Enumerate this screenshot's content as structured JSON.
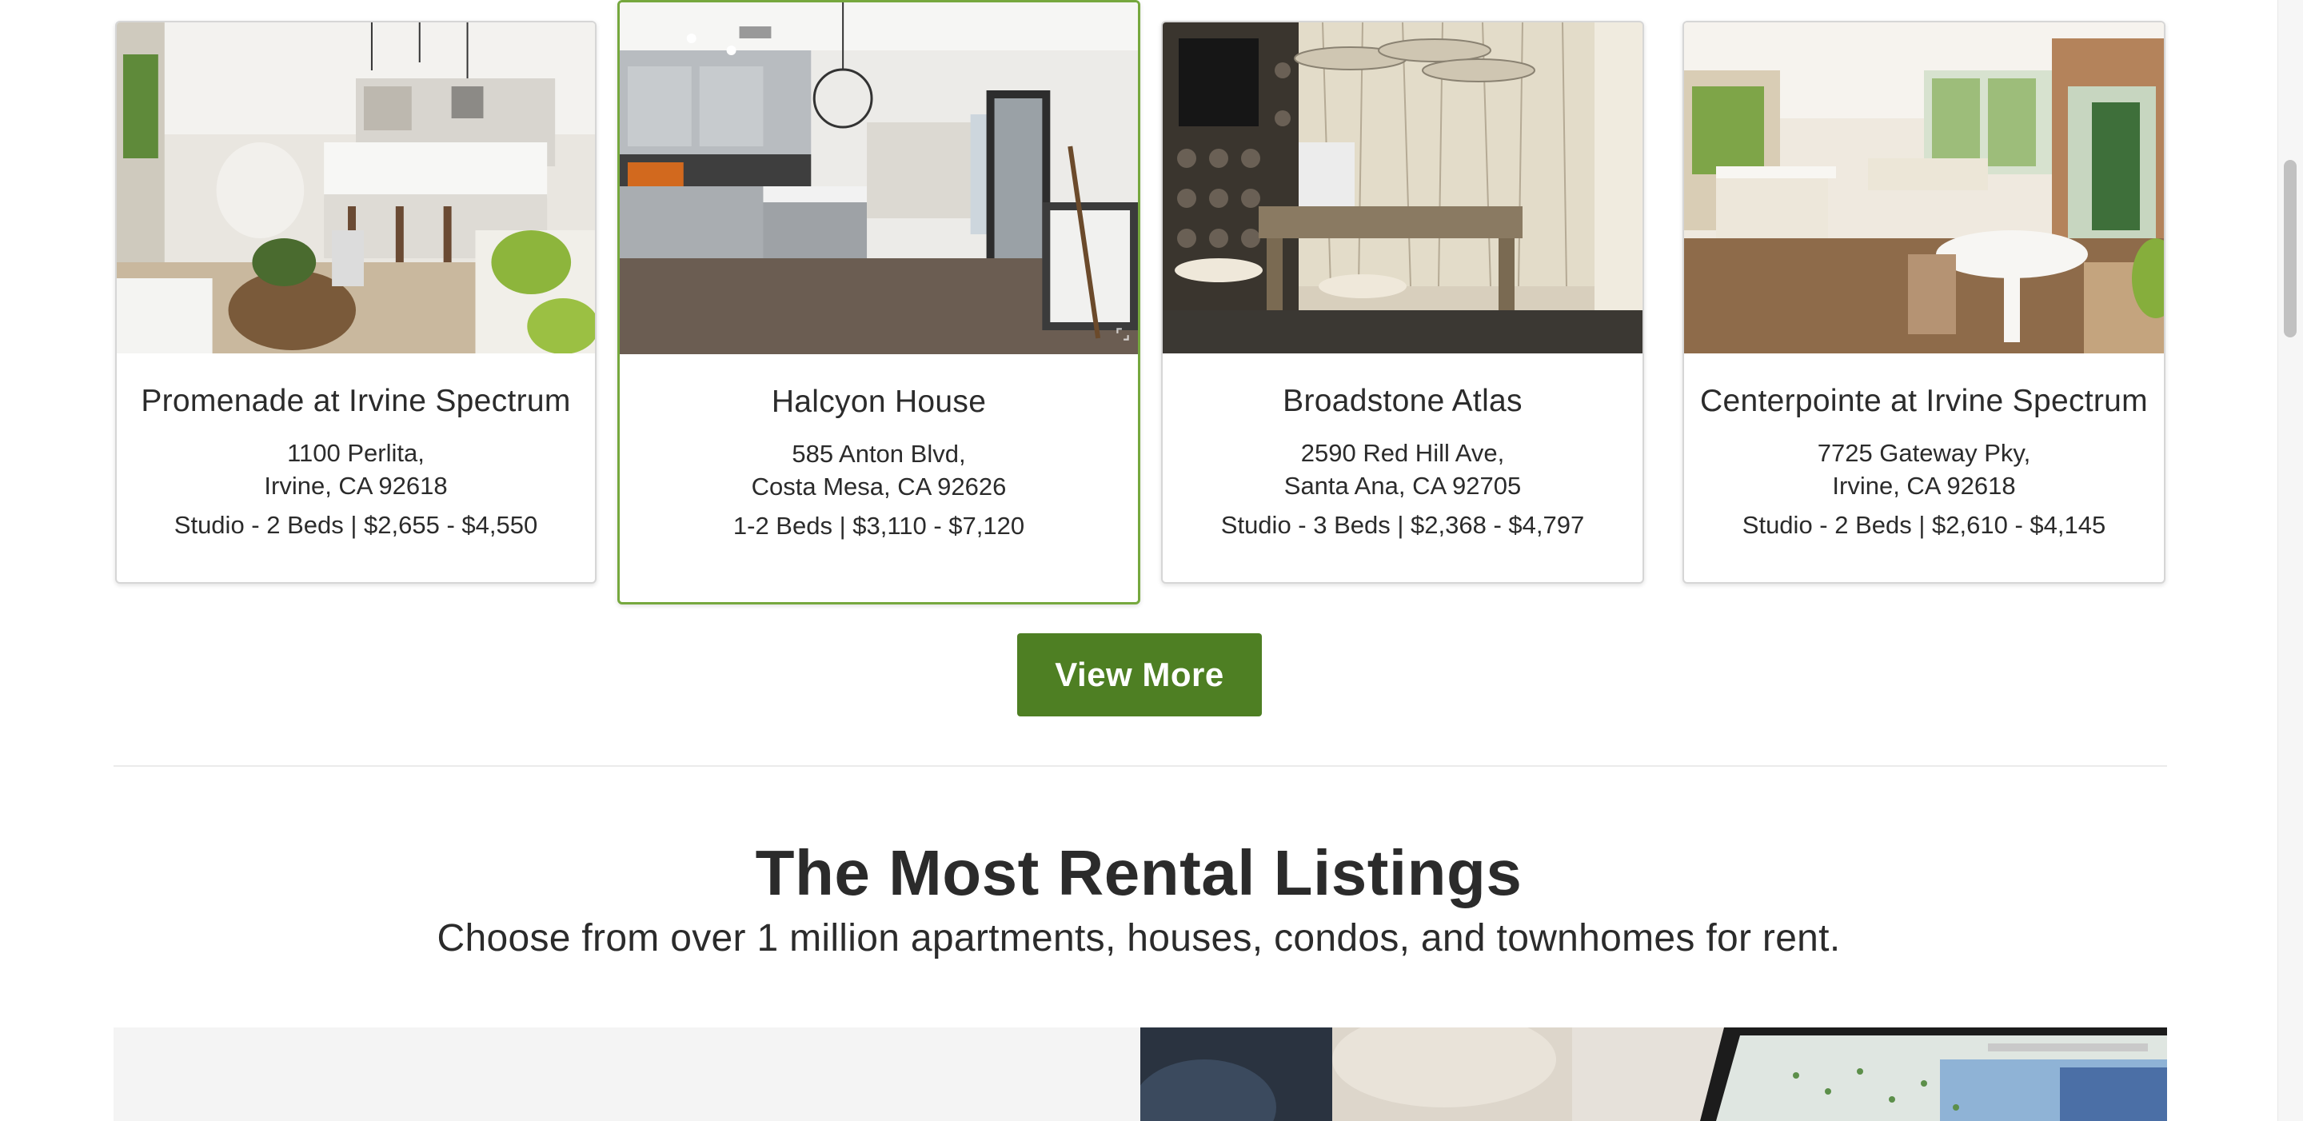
{
  "listings": [
    {
      "name": "Promenade at Irvine Spectrum",
      "address_line1": "1100 Perlita,",
      "address_line2": "Irvine, CA 92618",
      "details": "Studio - 2 Beds | $2,655 - $4,550"
    },
    {
      "name": "Halcyon House",
      "address_line1": "585 Anton Blvd,",
      "address_line2": "Costa Mesa, CA 92626",
      "details": "1-2 Beds | $3,110 - $7,120"
    },
    {
      "name": "Broadstone Atlas",
      "address_line1": "2590 Red Hill Ave,",
      "address_line2": "Santa Ana, CA 92705",
      "details": "Studio - 3 Beds | $2,368 - $4,797"
    },
    {
      "name": "Centerpointe at Irvine Spectrum",
      "address_line1": "7725 Gateway Pky,",
      "address_line2": "Irvine, CA 92618",
      "details": "Studio - 2 Beds | $2,610 - $4,145"
    }
  ],
  "view_more_label": "View More",
  "section": {
    "title": "The Most Rental Listings",
    "subtitle": "Choose from over 1 million apartments, houses, condos, and townhomes for rent."
  },
  "colors": {
    "accent": "#4e7f23",
    "highlight_border": "#76a83e",
    "text": "#2b2b2b"
  },
  "icons": {
    "expand": "expand-icon"
  }
}
